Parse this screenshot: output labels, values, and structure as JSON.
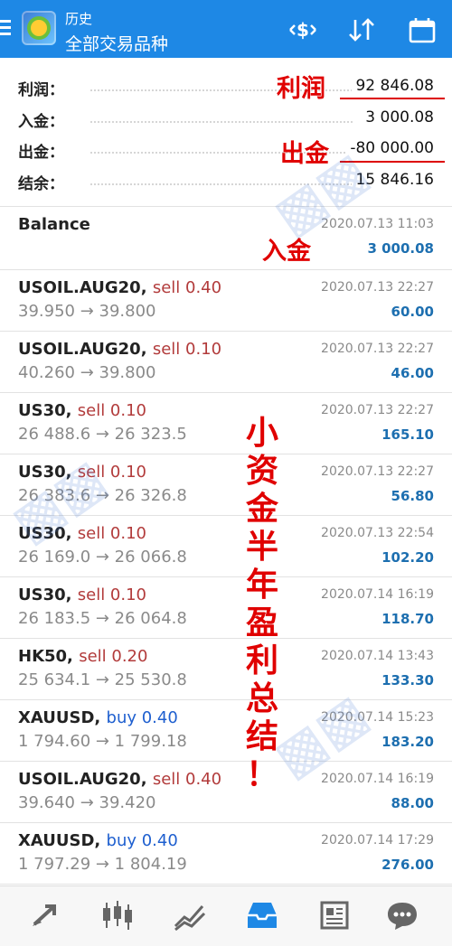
{
  "header": {
    "subtitle": "历史",
    "title": "全部交易品种"
  },
  "summary": [
    {
      "label": "利润：",
      "value": "92 846.08"
    },
    {
      "label": "入金：",
      "value": "3 000.08"
    },
    {
      "label": "出金：",
      "value": "-80 000.00"
    },
    {
      "label": "结余：",
      "value": "15 846.16"
    }
  ],
  "balance_entry": {
    "title": "Balance",
    "time": "2020.07.13 11:03",
    "amount": "3 000.08"
  },
  "trades": [
    {
      "symbol": "USOIL.AUG20,",
      "side": "sell 0.40",
      "prices": "39.950 → 39.800",
      "time": "2020.07.13 22:27",
      "profit": "60.00"
    },
    {
      "symbol": "USOIL.AUG20,",
      "side": "sell 0.10",
      "prices": "40.260 → 39.800",
      "time": "2020.07.13 22:27",
      "profit": "46.00"
    },
    {
      "symbol": "US30,",
      "side": "sell 0.10",
      "prices": "26 488.6 → 26 323.5",
      "time": "2020.07.13 22:27",
      "profit": "165.10"
    },
    {
      "symbol": "US30,",
      "side": "sell 0.10",
      "prices": "26 383.6 → 26 326.8",
      "time": "2020.07.13 22:27",
      "profit": "56.80"
    },
    {
      "symbol": "US30,",
      "side": "sell 0.10",
      "prices": "26 169.0 → 26 066.8",
      "time": "2020.07.13 22:54",
      "profit": "102.20"
    },
    {
      "symbol": "US30,",
      "side": "sell 0.10",
      "prices": "26 183.5 → 26 064.8",
      "time": "2020.07.14 16:19",
      "profit": "118.70"
    },
    {
      "symbol": "HK50,",
      "side": "sell 0.20",
      "prices": "25 634.1 → 25 530.8",
      "time": "2020.07.14 13:43",
      "profit": "133.30"
    },
    {
      "symbol": "XAUUSD,",
      "side": "buy 0.40",
      "prices": "1 794.60 → 1 799.18",
      "time": "2020.07.14 15:23",
      "profit": "183.20"
    },
    {
      "symbol": "USOIL.AUG20,",
      "side": "sell 0.40",
      "prices": "39.640 → 39.420",
      "time": "2020.07.14 16:19",
      "profit": "88.00"
    },
    {
      "symbol": "XAUUSD,",
      "side": "buy 0.40",
      "prices": "1 797.29 → 1 804.19",
      "time": "2020.07.14 17:29",
      "profit": "276.00"
    }
  ],
  "annotations": {
    "profit": "利润",
    "withdraw": "出金",
    "deposit": "入金",
    "vertical": [
      "小",
      "资",
      "金",
      "半",
      "年",
      "盈",
      "利",
      "总",
      "结",
      "！"
    ]
  },
  "bottom_nav": [
    "trade-arrows-icon",
    "candlestick-icon",
    "chart-line-icon",
    "history-inbox-icon",
    "news-icon",
    "chat-icon"
  ],
  "colors": {
    "toolbar": "#1e88e5",
    "sell": "#b23b3b",
    "buy": "#1e5fcf",
    "profit": "#1d6fb0",
    "annotation": "#e00000",
    "active_nav": "#1e88e5"
  }
}
